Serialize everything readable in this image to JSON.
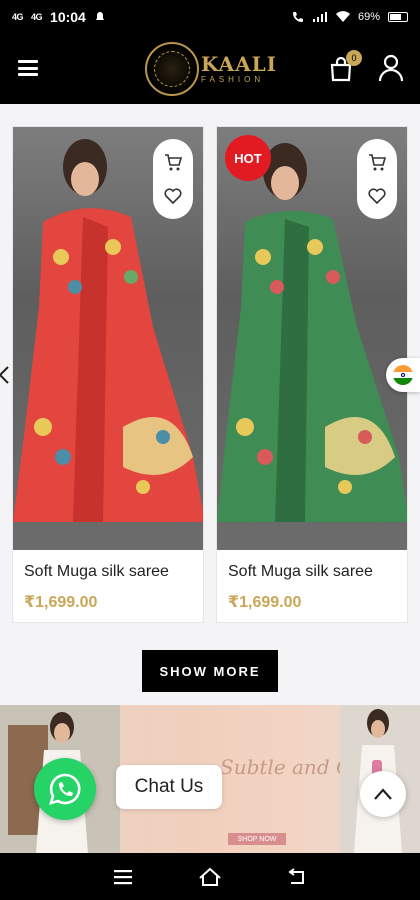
{
  "status_bar": {
    "network_1": "4G",
    "network_2": "4G",
    "time": "10:04",
    "battery": "69%"
  },
  "header": {
    "logo_brand": "KAALI",
    "logo_sub": "FASHION",
    "cart_count": "0"
  },
  "products": [
    {
      "name": "Soft Muga silk saree",
      "price": "₹1,699.00",
      "badge": "",
      "saree_color": "#e2463e",
      "border_color": "#c7332c"
    },
    {
      "name": "Soft Muga silk saree",
      "price": "₹1,699.00",
      "badge": "HOT",
      "saree_color": "#3f8c54",
      "border_color": "#2f6e40"
    }
  ],
  "show_more_label": "SHOW MORE",
  "banner": {
    "script_text": "Subtle and Classic",
    "button_label": "SHOP NOW"
  },
  "chat": {
    "label": "Chat Us"
  },
  "colors": {
    "accent_gold": "#c9a658",
    "whatsapp_green": "#25d366",
    "hot_red": "#e21b23"
  }
}
